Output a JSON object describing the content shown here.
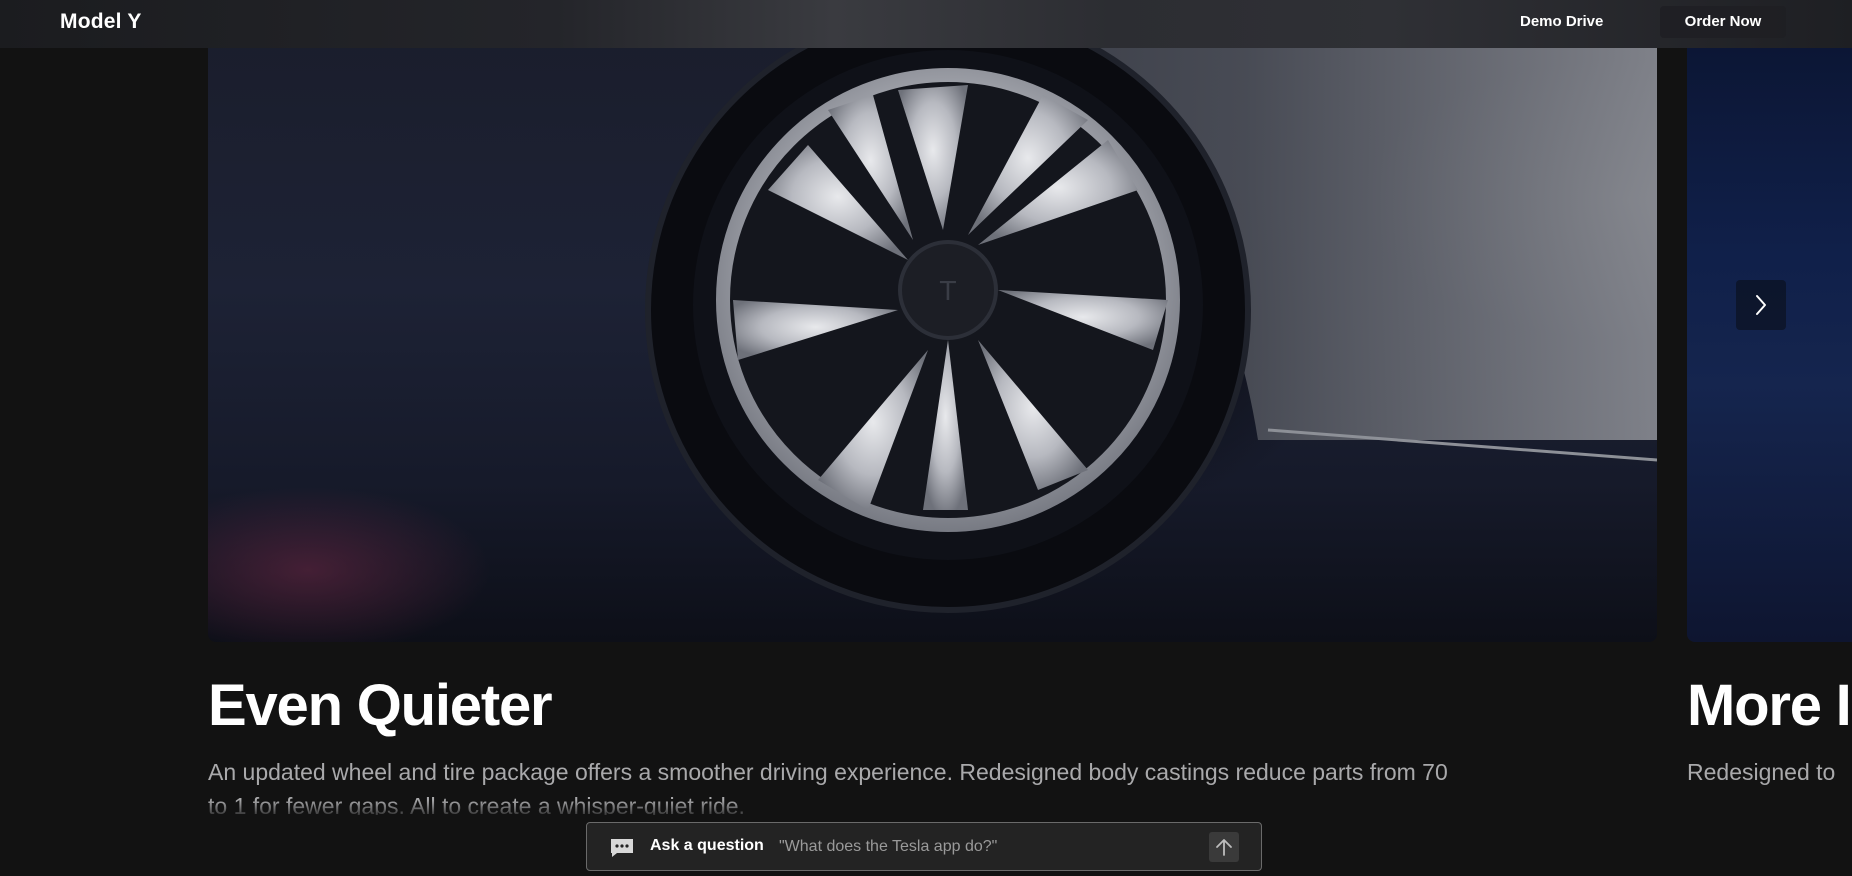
{
  "header": {
    "brand": "Model Y",
    "demo_drive_label": "Demo Drive",
    "order_now_label": "Order Now"
  },
  "slides": [
    {
      "title": "Even Quieter",
      "description": "An updated wheel and tire package offers a smoother driving experience. Redesigned body castings reduce parts from 70 to 1 for fewer gaps. All to create a whisper-quiet ride."
    },
    {
      "title": "More I",
      "description": "Redesigned to"
    }
  ],
  "carousel": {
    "next_icon": "chevron-right-icon"
  },
  "ask": {
    "label": "Ask a question",
    "placeholder": "\"What does the Tesla app do?\"",
    "chat_icon": "chat-bubble-icon",
    "send_icon": "arrow-up-icon"
  },
  "colors": {
    "background": "#121212",
    "text_primary": "#ffffff",
    "text_secondary": "#a9a9ab",
    "ask_bar_bg": "#232323"
  }
}
